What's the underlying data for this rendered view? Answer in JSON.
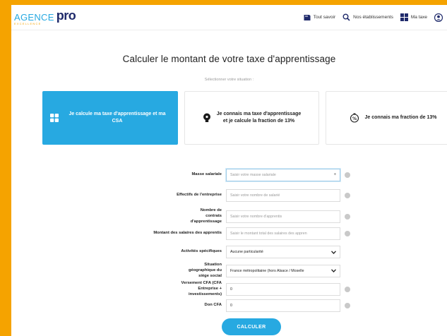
{
  "header": {
    "logo_agence": "AGENCE",
    "logo_pro": "pro",
    "logo_sub": "EXCELLENCE",
    "nav": [
      {
        "label": "Tout savoir",
        "icon": "book-icon"
      },
      {
        "label": "Nos établissements",
        "icon": "search-icon"
      },
      {
        "label": "Ma taxe",
        "icon": "grid-icon"
      },
      {
        "label": "",
        "icon": "user-icon"
      }
    ]
  },
  "main": {
    "title": "Calculer le montant de votre taxe d'apprentissage",
    "subtitle": "Sélectionner votre situation :",
    "cards": [
      {
        "label": "Je calcule ma taxe d'apprentissage et ma CSA",
        "icon": "calculator-icon",
        "active": true
      },
      {
        "label": "Je connais ma taxe d'apprentissage et je calcule la fraction de 13%",
        "icon": "bulb-icon",
        "active": false
      },
      {
        "label": "Je connais ma fraction de 13%",
        "icon": "percent-icon",
        "active": false
      }
    ]
  },
  "form": {
    "masse_label": "Masse salariale",
    "masse_placeholder": "Saisir votre masse salariale",
    "masse_stepper": "÷",
    "effectifs_label": "Effectifs de l'entreprise",
    "effectifs_placeholder": "Saisir votre nombre de salarié",
    "contrats_label": "Nombre de contrats d'apprentissage",
    "contrats_placeholder": "Saisir votre nombre d'apprentis",
    "salaires_label": "Montant des salaires des apprentis",
    "salaires_placeholder": "Saisir le montant total des salaires des appren",
    "activites_label": "Activités spécifiques",
    "activites_value": "Aucune particularité",
    "situation_label": "Situation géographique du siège social",
    "situation_value": "France métropolitaine (hors Alsace / Moselle",
    "versement_label": "Versement CFA (CFA Entreprise + investissements)",
    "versement_value": "0",
    "don_label": "Don CFA",
    "don_value": "0",
    "submit_label": "CALCULER"
  },
  "colors": {
    "accent": "#27a9e1",
    "brand_orange": "#f5a300",
    "brand_navy": "#1f2a6b"
  }
}
